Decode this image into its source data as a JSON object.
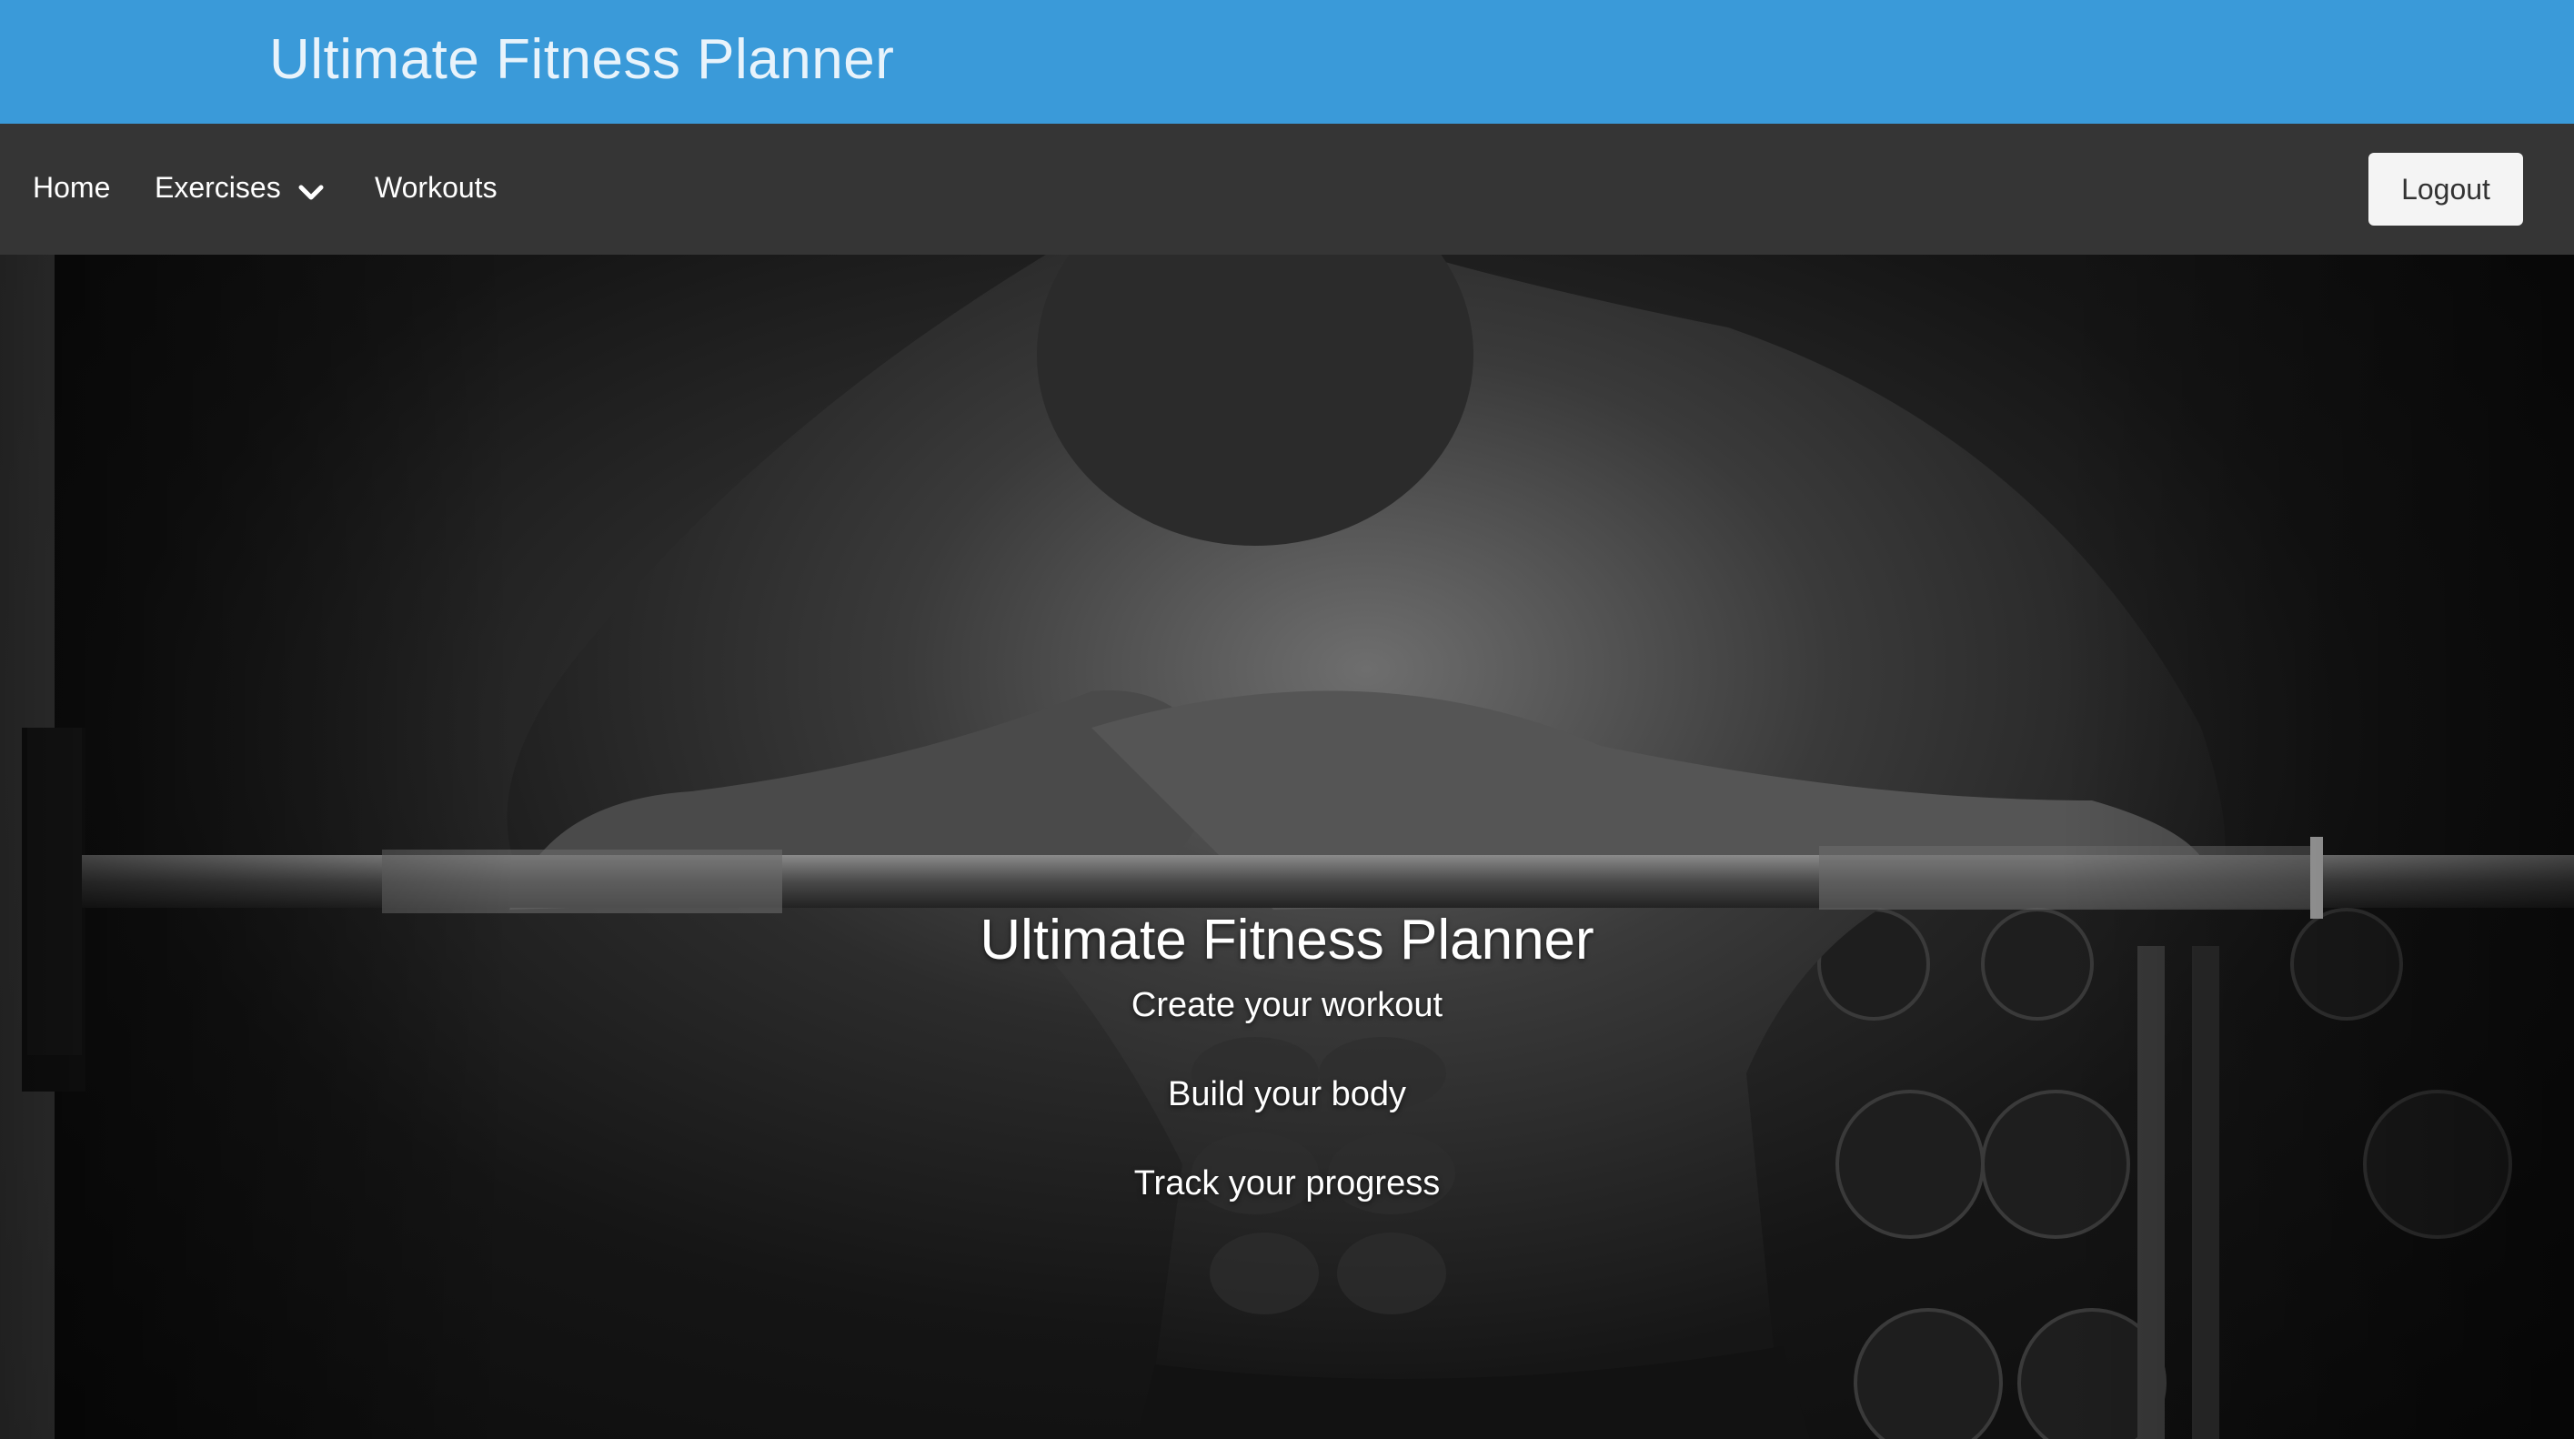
{
  "header": {
    "brand": "Ultimate Fitness Planner",
    "bg_color": "#3a9ad9"
  },
  "nav": {
    "items": [
      {
        "label": "Home"
      },
      {
        "label": "Exercises",
        "has_dropdown": true,
        "icon": "chevron-down-icon"
      },
      {
        "label": "Workouts"
      }
    ],
    "logout_label": "Logout",
    "bg_color": "#353535"
  },
  "hero": {
    "title": "Ultimate Fitness Planner",
    "lines": [
      "Create your workout",
      "Build your body",
      "Track your progress"
    ]
  }
}
